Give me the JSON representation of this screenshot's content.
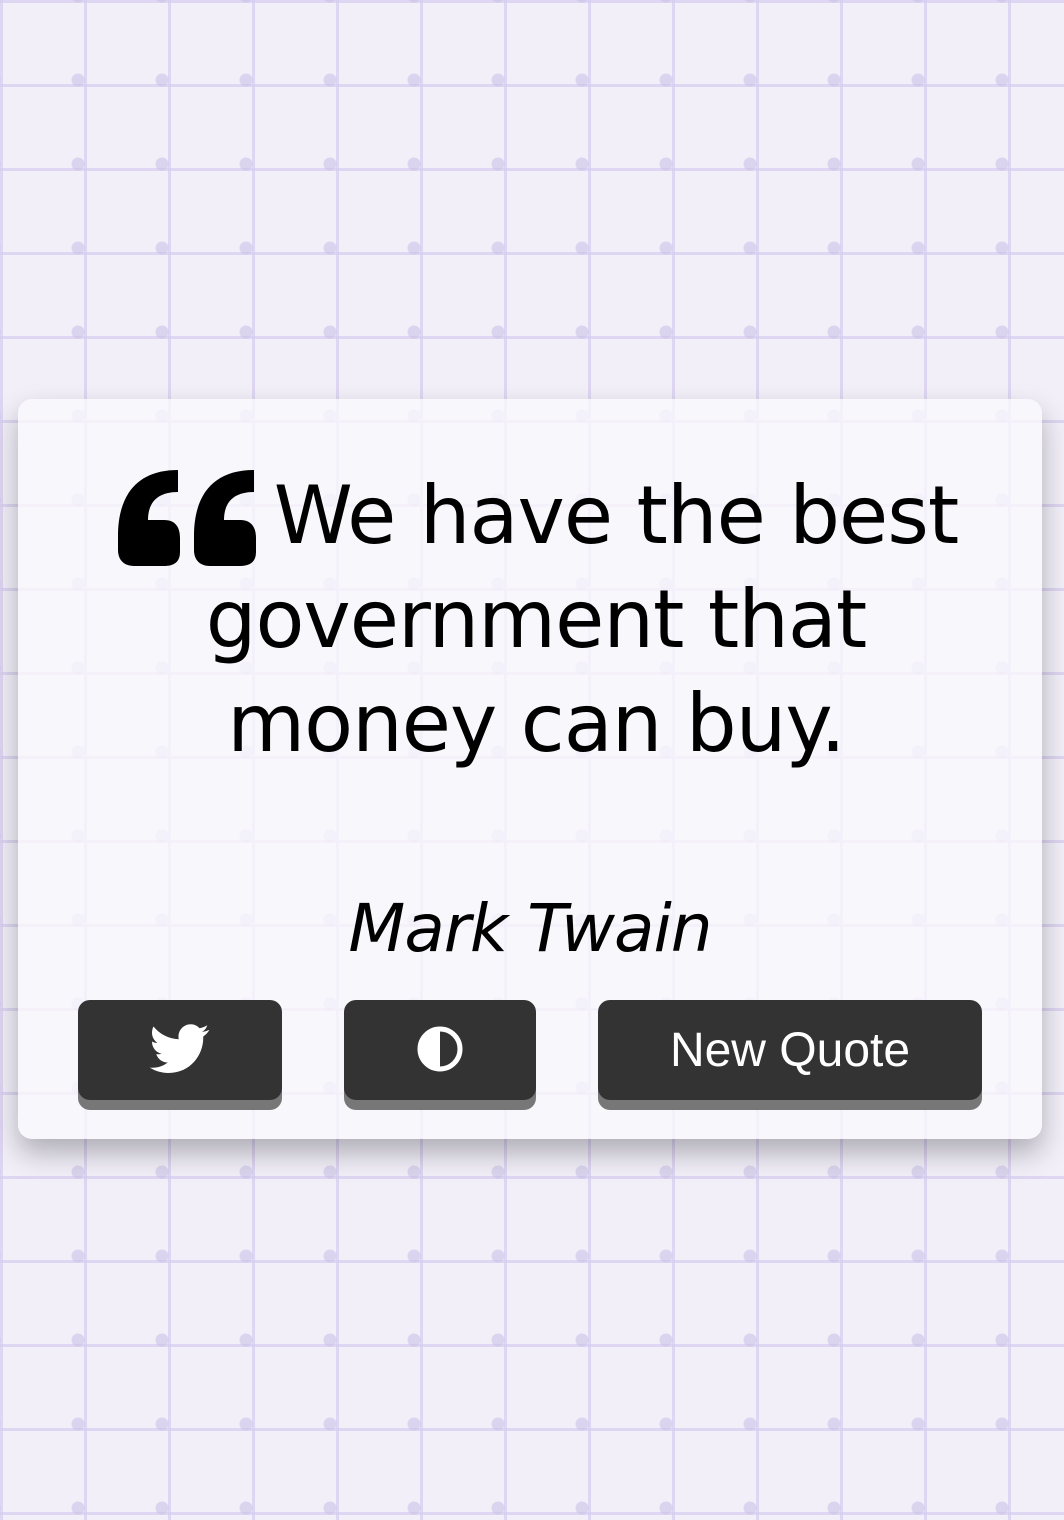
{
  "quote": {
    "text": "We have the best government that money can buy.",
    "author": "Mark Twain",
    "icon": "quote-left-icon"
  },
  "buttons": {
    "twitter": {
      "icon": "twitter-icon"
    },
    "theme": {
      "icon": "contrast-icon"
    },
    "new_quote_label": "New Quote"
  },
  "colors": {
    "background": "#f2eff9",
    "card": "#faf9fd",
    "button": "#333333",
    "button_text": "#ffffff"
  }
}
